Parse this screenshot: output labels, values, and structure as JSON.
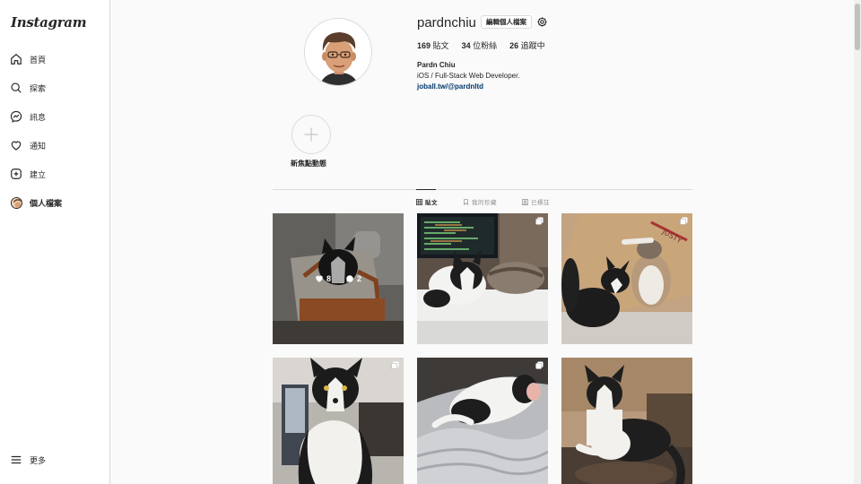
{
  "app": {
    "logo": "Instagram"
  },
  "sidebar": {
    "items": [
      {
        "label": "首頁",
        "icon": "home-icon"
      },
      {
        "label": "探索",
        "icon": "search-icon"
      },
      {
        "label": "訊息",
        "icon": "messenger-icon"
      },
      {
        "label": "通知",
        "icon": "heart-icon"
      },
      {
        "label": "建立",
        "icon": "create-icon"
      },
      {
        "label": "個人檔案",
        "icon": "avatar"
      }
    ],
    "more_label": "更多"
  },
  "profile": {
    "username": "pardnchiu",
    "edit_label": "編輯個人檔案",
    "stats": [
      {
        "count": "169",
        "label": "貼文"
      },
      {
        "count": "34",
        "label": "位粉絲"
      },
      {
        "count": "26",
        "label": "追蹤中"
      }
    ],
    "full_name": "Pardn Chiu",
    "bio": "iOS / Full-Stack Web Developer.",
    "link": "joball.tw/@pardnltd"
  },
  "highlights": {
    "new_label": "新焦點動態"
  },
  "tabs": [
    {
      "label": "貼文",
      "icon": "grid-icon",
      "active": true
    },
    {
      "label": "我的珍藏",
      "icon": "bookmark-icon",
      "active": false
    },
    {
      "label": "已標註",
      "icon": "tagged-icon",
      "active": false
    }
  ],
  "posts": [
    {
      "likes": "8",
      "comments": "2",
      "hover": true,
      "multi": false
    },
    {
      "multi": true
    },
    {
      "multi": true
    },
    {
      "multi": true
    },
    {
      "multi": true
    },
    {
      "multi": false
    }
  ],
  "colors": {
    "accent_link": "#00376b",
    "border": "#dbdbdb",
    "text": "#262626",
    "muted": "#8e8e8e"
  }
}
